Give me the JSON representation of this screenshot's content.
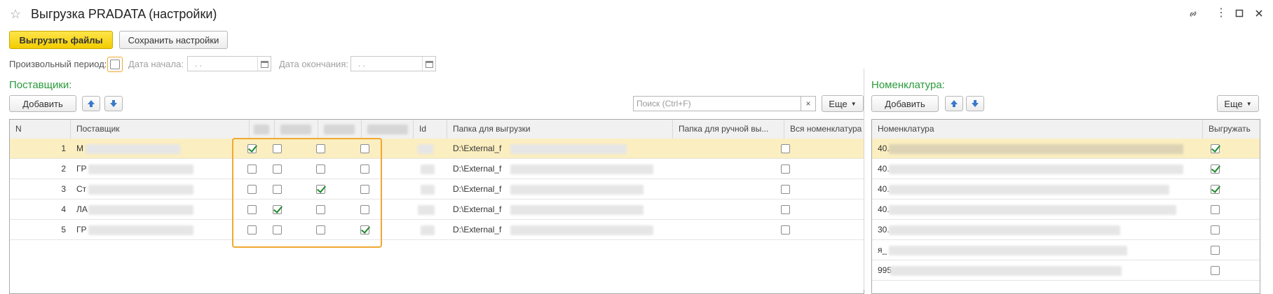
{
  "window": {
    "title": "Выгрузка PRADATA (настройки)"
  },
  "toolbar": {
    "export_label": "Выгрузить файлы",
    "save_label": "Сохранить настройки"
  },
  "period": {
    "arbitrary_label": "Произвольный период:",
    "arbitrary_checked": false,
    "start_label": "Дата начала:",
    "start_value": ". .",
    "end_label": "Дата окончания:",
    "end_value": ". ."
  },
  "suppliers": {
    "title": "Поставщики:",
    "add_label": "Добавить",
    "search_placeholder": "Поиск (Ctrl+F)",
    "search_clear": "×",
    "more_label": "Еще",
    "columns": {
      "n": "N",
      "supplier": "Поставщик",
      "id": "Id",
      "folder": "Папка для выгрузки",
      "manual_folder": "Папка для ручной вы...",
      "all_items": "Вся номенклатура"
    },
    "rows": [
      {
        "n": "1",
        "supplier_prefix": "М",
        "folder": "D:\\External_f",
        "flags": [
          true,
          false,
          false,
          false
        ],
        "all_items": false,
        "selected": true
      },
      {
        "n": "2",
        "supplier_prefix": "ГР",
        "folder": "D:\\External_f",
        "flags": [
          false,
          false,
          false,
          false
        ],
        "all_items": false,
        "selected": false
      },
      {
        "n": "3",
        "supplier_prefix": "Ст",
        "folder": "D:\\External_f",
        "flags": [
          false,
          false,
          true,
          false
        ],
        "all_items": false,
        "selected": false
      },
      {
        "n": "4",
        "supplier_prefix": "ЛА",
        "folder": "D:\\External_f",
        "flags": [
          false,
          true,
          false,
          false
        ],
        "all_items": false,
        "selected": false
      },
      {
        "n": "5",
        "supplier_prefix": "ГР",
        "folder": "D:\\External_f",
        "flags": [
          false,
          false,
          false,
          true
        ],
        "all_items": false,
        "selected": false
      }
    ]
  },
  "nomenclature": {
    "title": "Номенклатура:",
    "add_label": "Добавить",
    "more_label": "Еще",
    "columns": {
      "item": "Номенклатура",
      "export": "Выгружать"
    },
    "rows": [
      {
        "item_prefix": "40.",
        "export": true,
        "selected": true
      },
      {
        "item_prefix": "40.",
        "export": true,
        "selected": false
      },
      {
        "item_prefix": "40.",
        "export": true,
        "selected": false
      },
      {
        "item_prefix": "40.",
        "export": false,
        "selected": false
      },
      {
        "item_prefix": "30.",
        "export": false,
        "selected": false
      },
      {
        "item_prefix": "я_",
        "export": false,
        "selected": false
      },
      {
        "item_prefix": "995",
        "export": false,
        "selected": false
      }
    ]
  },
  "colors": {
    "accent_yellow": "#f2cc00",
    "section_green": "#2a9a3a",
    "check_green": "#1f8a2e",
    "selected_row": "#fbeec0",
    "highlight_orange": "#f0a830"
  }
}
